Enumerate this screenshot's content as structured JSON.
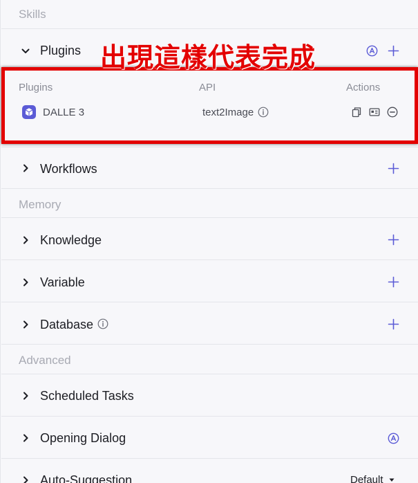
{
  "sections": {
    "skills": "Skills",
    "memory": "Memory",
    "advanced": "Advanced"
  },
  "rows": {
    "plugins": "Plugins",
    "workflows": "Workflows",
    "knowledge": "Knowledge",
    "variable": "Variable",
    "database": "Database",
    "scheduled_tasks": "Scheduled Tasks",
    "opening_dialog": "Opening Dialog",
    "auto_suggestion": "Auto-Suggestion"
  },
  "plugin_table": {
    "headers": {
      "plugins": "Plugins",
      "api": "API",
      "actions": "Actions"
    },
    "rows": [
      {
        "name": "DALLE 3",
        "api": "text2Image"
      }
    ]
  },
  "annotation": "出現這樣代表完成",
  "auto_suggestion_value": "Default",
  "colors": {
    "accent": "#5b5bd6",
    "highlight": "#e30000",
    "muted": "#a8aab3"
  },
  "icons": {
    "collapse": "chevron-down-icon",
    "expand": "chevron-right-icon",
    "add": "plus-icon",
    "auto": "auto-badge-icon",
    "info": "info-icon",
    "copy": "copy-icon",
    "card": "card-icon",
    "remove": "minus-circle-icon",
    "plugin": "cube-icon"
  }
}
